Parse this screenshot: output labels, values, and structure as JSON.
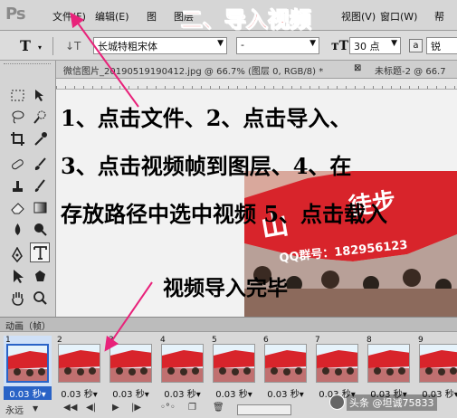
{
  "app": {
    "logo": "Ps"
  },
  "menu": [
    {
      "name": "menu-file",
      "label": "文件(F)"
    },
    {
      "name": "menu-edit",
      "label": "编辑(E)"
    },
    {
      "name": "menu-image",
      "label": "图"
    },
    {
      "name": "menu-layer",
      "label": "图层"
    },
    {
      "name": "menu-view",
      "label": "视图(V)"
    },
    {
      "name": "menu-window",
      "label": "窗口(W)"
    },
    {
      "name": "menu-help",
      "label": "帮"
    }
  ],
  "overlay_title": "二、导入视频",
  "options": {
    "tool_glyph": "T",
    "font_family": "长城特粗宋体",
    "font_style": "-",
    "size_value": "30 点",
    "aa_label": "a",
    "aa_value": "锐"
  },
  "tabs": [
    {
      "label": "微信图片_20190519190412.jpg @ 66.7% (图层 0, RGB/8) *"
    },
    {
      "label": "未标题-2 @ 66.7"
    }
  ],
  "instructions": [
    "1、点击文件、2、点击导入、",
    "3、点击视频帧到图层、4、在",
    "存放路径中选中视频 5、点击载入"
  ],
  "status_text": "视频导入完毕",
  "photo": {
    "banner_text": "山",
    "banner_text2": "徒步",
    "qq_text": "QQ群号：182956123"
  },
  "animation": {
    "title": "动画（帧）",
    "frames": [
      {
        "num": "1",
        "delay": "0.03 秒▾",
        "selected": true
      },
      {
        "num": "2",
        "delay": "0.03 秒▾",
        "selected": false
      },
      {
        "num": "3",
        "delay": "0.03 秒▾",
        "selected": false
      },
      {
        "num": "4",
        "delay": "0.03 秒▾",
        "selected": false
      },
      {
        "num": "5",
        "delay": "0.03 秒▾",
        "selected": false
      },
      {
        "num": "6",
        "delay": "0.03 秒▾",
        "selected": false
      },
      {
        "num": "7",
        "delay": "0.03 秒▾",
        "selected": false
      },
      {
        "num": "8",
        "delay": "0.03 秒▾",
        "selected": false
      },
      {
        "num": "9",
        "delay": "0.03 秒▾",
        "selected": false
      }
    ],
    "loop": "永远"
  },
  "watermark": "头条 @坦诚75833",
  "colors": {
    "accent_red": "#e8222a",
    "arrow": "#e8227a",
    "selection_blue": "#2a63c6"
  }
}
